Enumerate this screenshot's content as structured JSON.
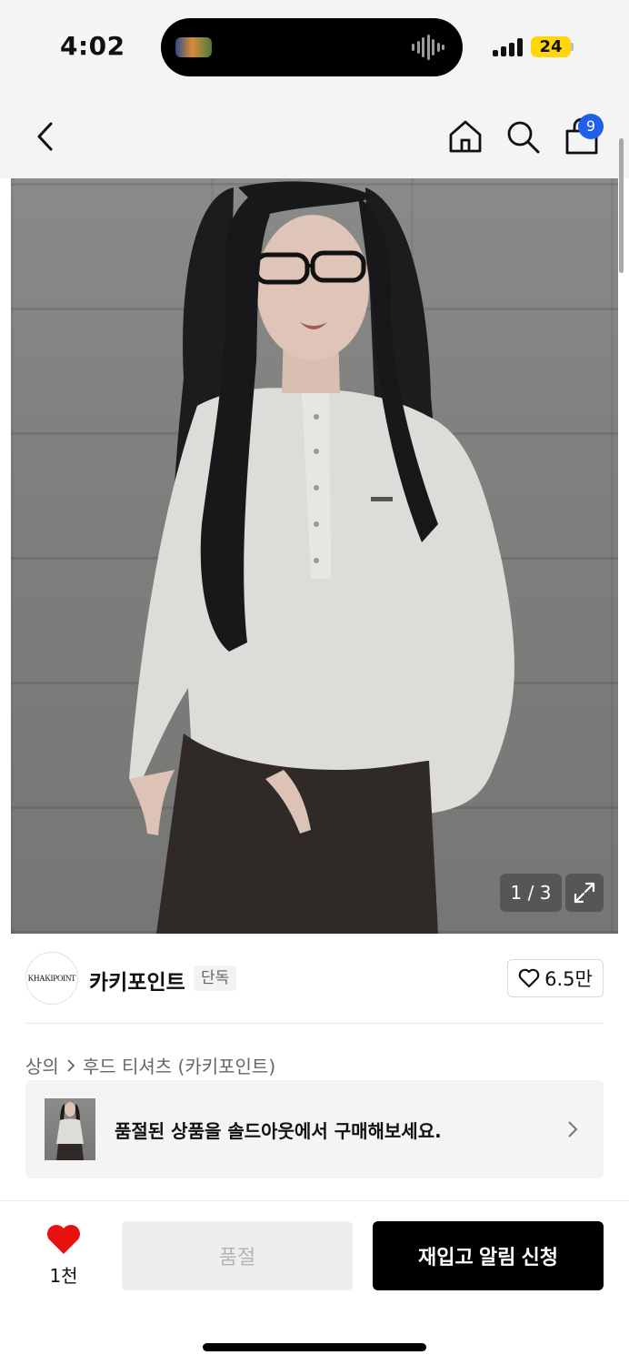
{
  "status_bar": {
    "time": "4:02",
    "battery": "24",
    "colors": {
      "battery": "#ffd60a",
      "island": "#000000"
    }
  },
  "nav": {
    "icons": [
      "chevron-left-icon",
      "home-icon",
      "search-icon",
      "shopping-bag-icon"
    ],
    "cart_count": "9",
    "colors": {
      "badge": "#1f5fea"
    }
  },
  "gallery": {
    "counter": "1 / 3",
    "current": 1,
    "total": 3,
    "expand_icon": "expand-icon"
  },
  "brand": {
    "logo_text": "KHAKIPOINT",
    "name": "카키포인트",
    "tag": "단독",
    "likes": "6.5만"
  },
  "breadcrumb": {
    "items": [
      "상의",
      "후드 티셔츠 (카키포인트)"
    ],
    "separator_icon": "chevron-right-icon"
  },
  "soldout_banner": {
    "text": "품절된 상품을 솔드아웃에서 구매해보세요."
  },
  "bottom_bar": {
    "wish_count": "1천",
    "soldout_label": "품절",
    "restock_label": "재입고 알림 신청",
    "colors": {
      "heart": "#e8110f",
      "primary": "#000000",
      "disabled": "#eeeeee"
    }
  }
}
